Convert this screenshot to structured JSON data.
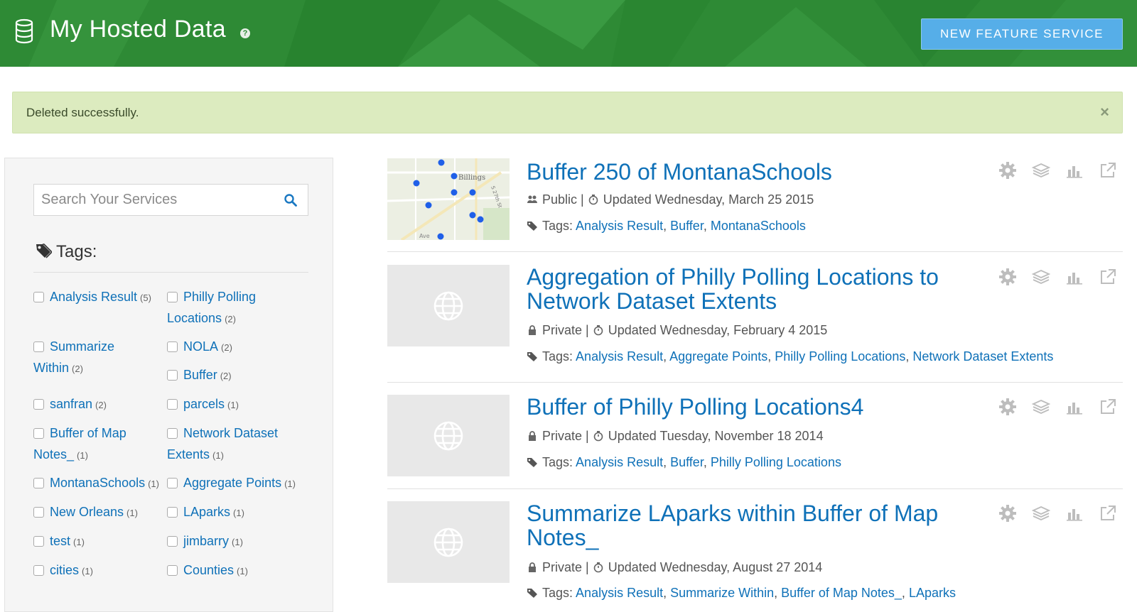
{
  "header": {
    "title": "My Hosted Data",
    "help_glyph": "?",
    "new_button": "NEW FEATURE SERVICE",
    "icon": "database-icon"
  },
  "alert": {
    "message": "Deleted successfully.",
    "close_glyph": "×"
  },
  "sidebar": {
    "search_placeholder": "Search Your Services",
    "tags_title": "Tags:",
    "tags": [
      {
        "label": "Analysis Result",
        "count": "(5)"
      },
      {
        "label": "Philly Polling Locations",
        "count": "(2)"
      },
      {
        "label": "Summarize Within",
        "count": "(2)"
      },
      {
        "label": "NOLA",
        "count": "(2)"
      },
      {
        "label": "Buffer",
        "count": "(2)"
      },
      {
        "label": "sanfran",
        "count": "(2)"
      },
      {
        "label": "parcels",
        "count": "(1)"
      },
      {
        "label": "Buffer of Map Notes_",
        "count": "(1)"
      },
      {
        "label": "Network Dataset Extents",
        "count": "(1)"
      },
      {
        "label": "MontanaSchools",
        "count": "(1)"
      },
      {
        "label": "Aggregate Points",
        "count": "(1)"
      },
      {
        "label": "New Orleans",
        "count": "(1)"
      },
      {
        "label": "LAparks",
        "count": "(1)"
      },
      {
        "label": "test",
        "count": "(1)"
      },
      {
        "label": "jimbarry",
        "count": "(1)"
      },
      {
        "label": "cities",
        "count": "(1)"
      },
      {
        "label": "Counties",
        "count": "(1)"
      }
    ]
  },
  "items": [
    {
      "title": "Buffer 250 of MontanaSchools",
      "access": "Public",
      "updated": "Updated Wednesday, March 25 2015",
      "tags_label": "Tags:",
      "tags": [
        "Analysis Result",
        "Buffer",
        "MontanaSchools"
      ],
      "map_labels": {
        "city": "Billings",
        "street": "S 27th St",
        "ave": "Ave"
      }
    },
    {
      "title": "Aggregation of Philly Polling Locations to Network Dataset Extents",
      "access": "Private",
      "updated": "Updated Wednesday, February 4 2015",
      "tags_label": "Tags:",
      "tags": [
        "Analysis Result",
        "Aggregate Points",
        "Philly Polling Locations",
        "Network Dataset Extents"
      ]
    },
    {
      "title": "Buffer of Philly Polling Locations4",
      "access": "Private",
      "updated": "Updated Tuesday, November 18 2014",
      "tags_label": "Tags:",
      "tags": [
        "Analysis Result",
        "Buffer",
        "Philly Polling Locations"
      ]
    },
    {
      "title": "Summarize LAparks within Buffer of Map Notes_",
      "access": "Private",
      "updated": "Updated Wednesday, August 27 2014",
      "tags_label": "Tags:",
      "tags": [
        "Analysis Result",
        "Summarize Within",
        "Buffer of Map Notes_",
        "LAparks"
      ]
    }
  ],
  "colors": {
    "header_green": "#2e8a35",
    "button_blue": "#56aee8",
    "link_blue": "#0f71b8",
    "alert_bg": "#dcebbf"
  }
}
